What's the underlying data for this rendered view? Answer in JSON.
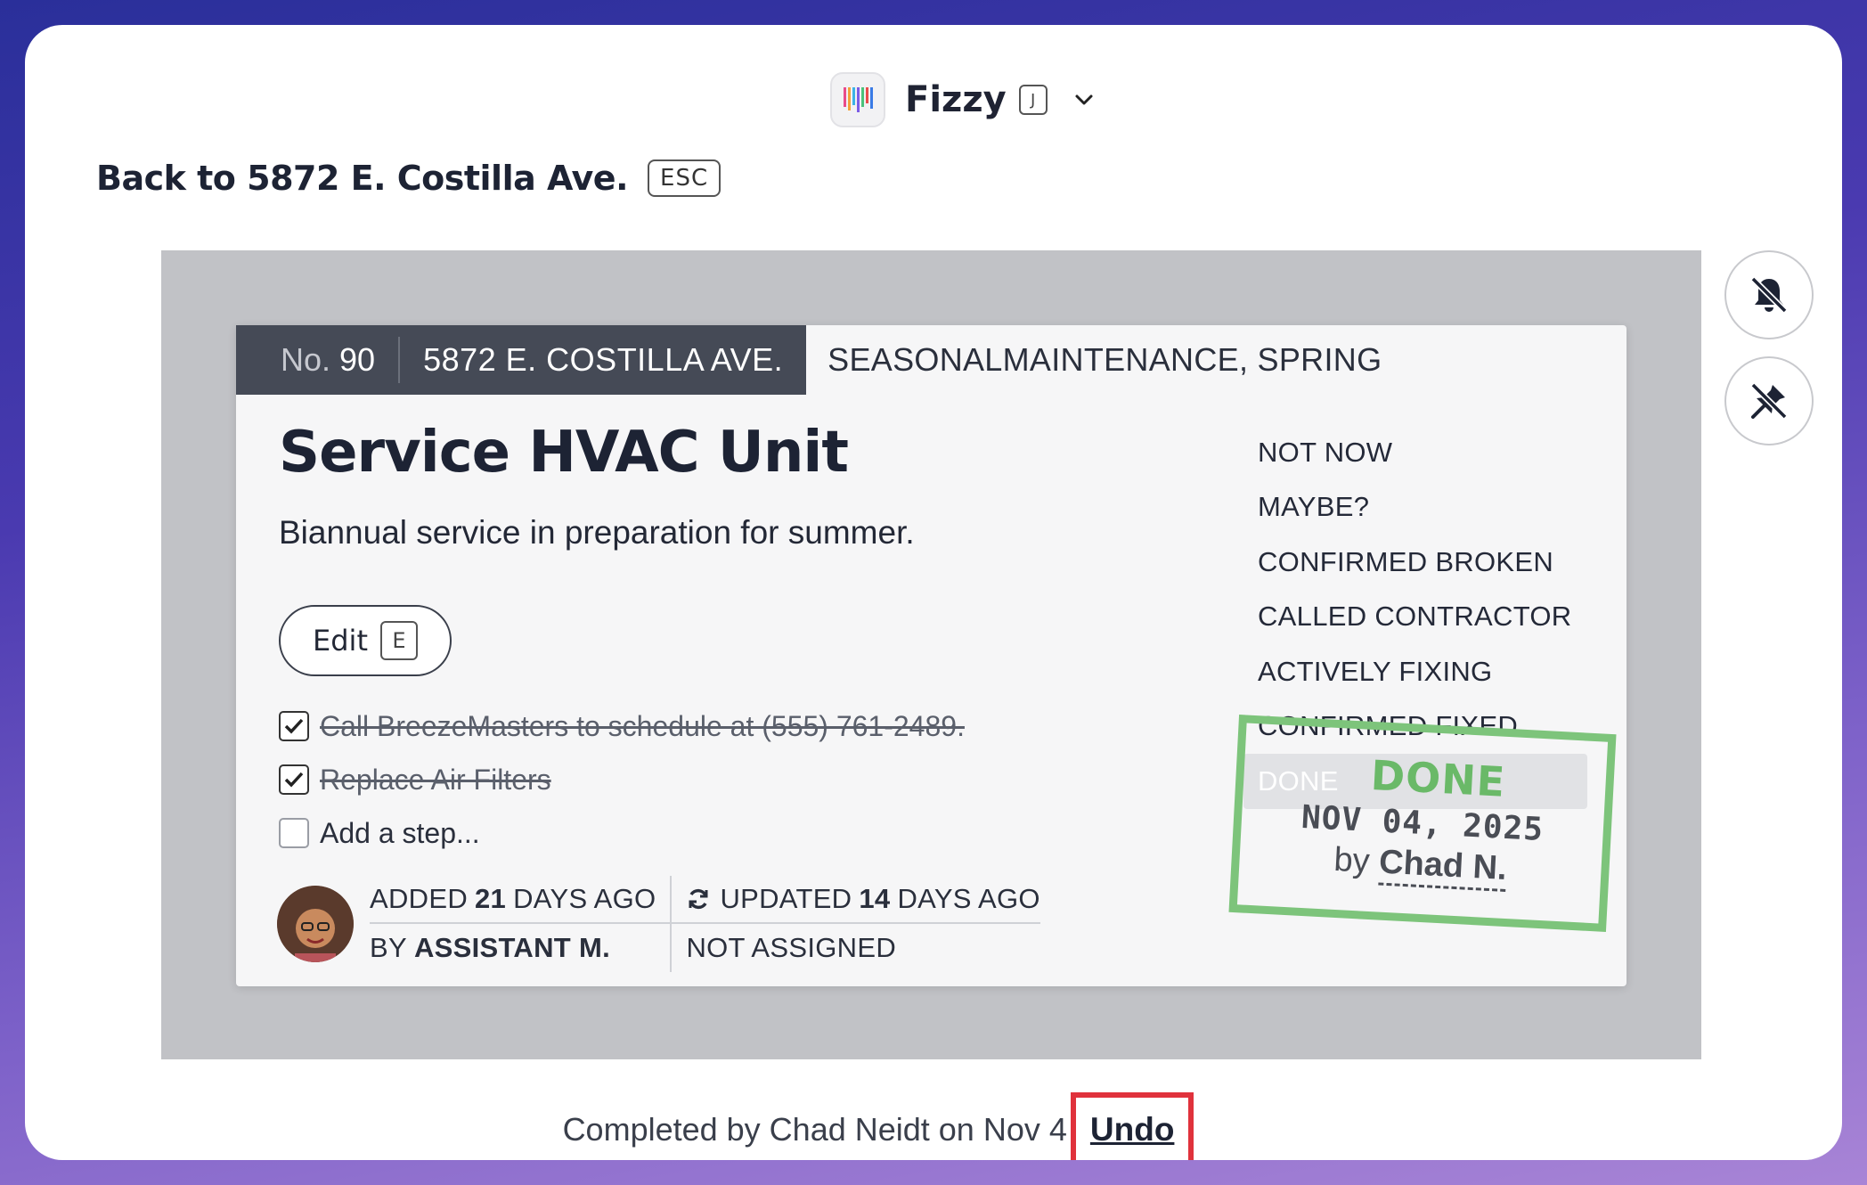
{
  "brand": {
    "name": "Fizzy",
    "shortcut": "J"
  },
  "back": {
    "label": "Back to 5872 E. Costilla Ave.",
    "shortcut": "ESC"
  },
  "card": {
    "number_prefix": "No.",
    "number": "90",
    "address": "5872 E. COSTILLA AVE.",
    "tags": "SEASONALMAINTENANCE, SPRING",
    "title": "Service HVAC Unit",
    "description": "Biannual service in preparation for summer.",
    "edit": {
      "label": "Edit",
      "shortcut": "E"
    },
    "steps": [
      {
        "text": "Call BreezeMasters to schedule at (555) 761-2489.",
        "checked": true
      },
      {
        "text": "Replace Air Filters",
        "checked": true
      }
    ],
    "add_step_placeholder": "Add a step...",
    "meta": {
      "added_prefix": "ADDED",
      "added_days": "21",
      "added_suffix": "DAYS AGO",
      "updated_prefix": "UPDATED",
      "updated_days": "14",
      "updated_suffix": "DAYS AGO",
      "by_prefix": "BY",
      "by_name": "ASSISTANT M.",
      "assigned": "NOT ASSIGNED"
    },
    "statuses": [
      "NOT NOW",
      "MAYBE?",
      "CONFIRMED BROKEN",
      "CALLED CONTRACTOR",
      "ACTIVELY FIXING",
      "CONFIRMED FIXED",
      "DONE"
    ],
    "selected_status": "DONE",
    "stamp": {
      "word": "DONE",
      "date": "NOV 04, 2025",
      "by_prefix": "by",
      "by_name": "Chad N."
    }
  },
  "side_actions": {
    "mute_icon": "bell-slash-icon",
    "unpin_icon": "pin-slash-icon"
  },
  "footer": {
    "text": "Completed by Chad Neidt on Nov 4",
    "undo_label": "Undo"
  },
  "colors": {
    "stamp": "#7dc47b",
    "undo_highlight": "#e0323c",
    "tag_bg": "#454a56"
  }
}
